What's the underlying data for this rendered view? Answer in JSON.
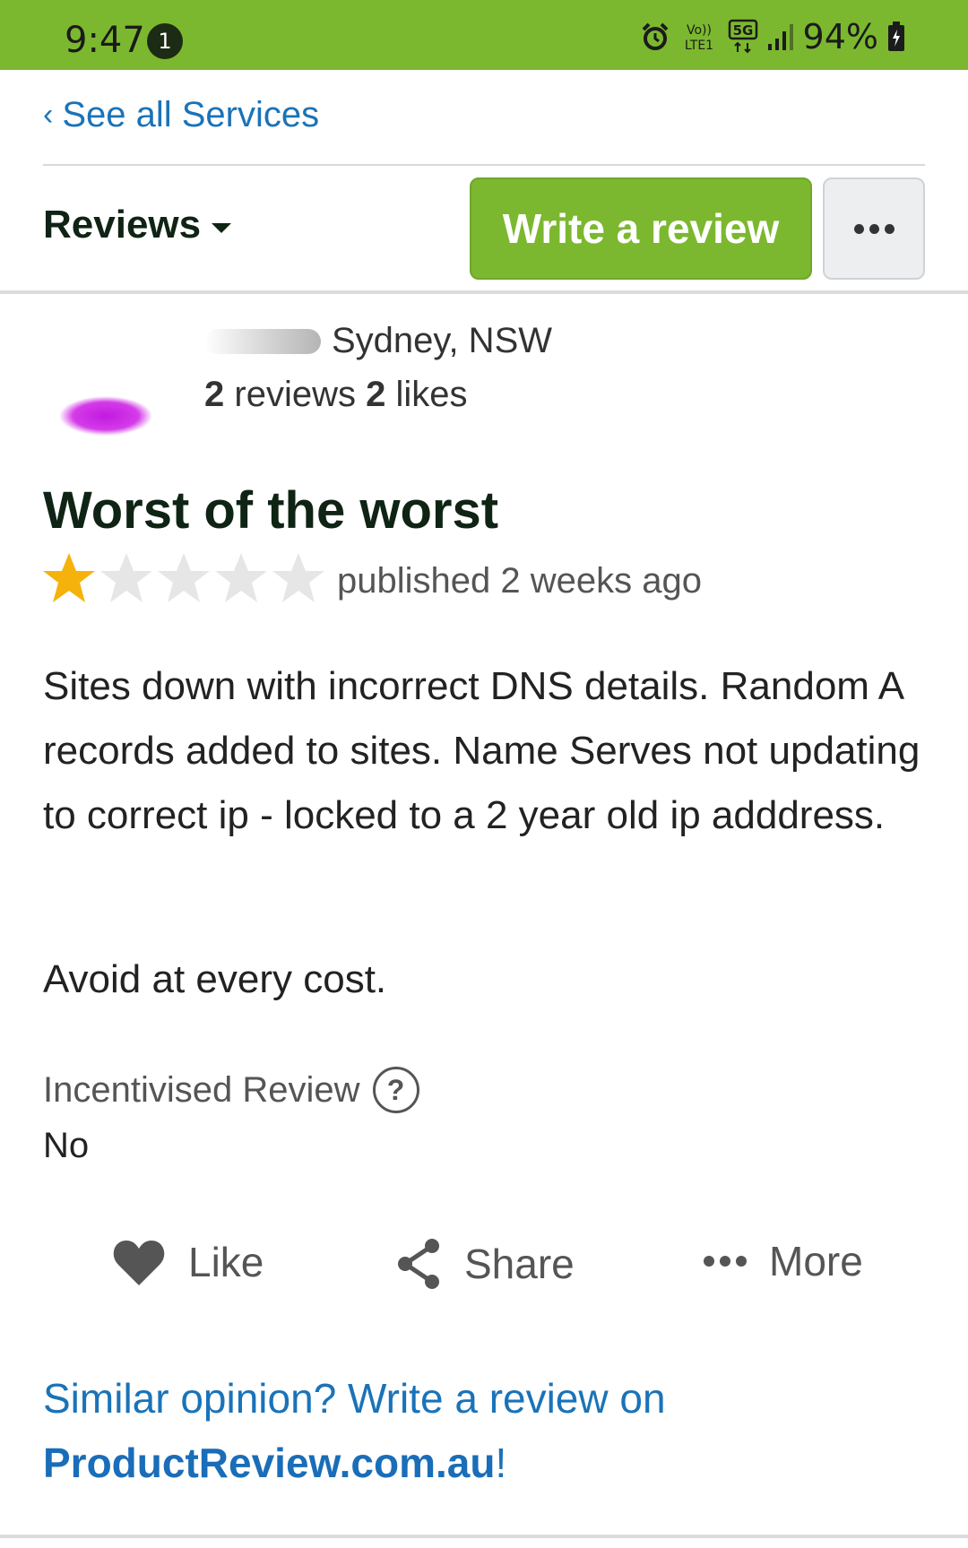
{
  "status_bar": {
    "time": "9:47",
    "notification_count": "1",
    "network_labels": [
      "Vo))",
      "LTE1",
      "5G"
    ],
    "battery": "94%",
    "icons": [
      "alarm-icon",
      "volte-icon",
      "5g-icon",
      "signal-icon",
      "battery-charging-icon"
    ],
    "background_color": "#7cb82f"
  },
  "nav": {
    "back_label": "See all Services"
  },
  "toolbar": {
    "reviews_label": "Reviews",
    "write_review_label": "Write a review",
    "accent_color": "#7cb82f"
  },
  "reviewer": {
    "location": "Sydney, NSW",
    "reviews_count": "2",
    "reviews_word": "reviews",
    "likes_count": "2",
    "likes_word": "likes"
  },
  "review": {
    "title": "Worst of the worst",
    "rating": 1,
    "max_rating": 5,
    "published": "published 2 weeks ago",
    "body": "Sites down with incorrect DNS details. Random A records added to sites. Name Serves not updating to correct ip - locked to a 2 year old ip adddress.",
    "closing": "Avoid at every cost."
  },
  "incentivised": {
    "label": "Incentivised Review",
    "help_symbol": "?",
    "value": "No"
  },
  "actions": {
    "like_label": "Like",
    "share_label": "Share",
    "more_label": "More"
  },
  "cta": {
    "text": "Similar opinion? Write a review on",
    "link": "ProductReview.com.au",
    "suffix": "!"
  }
}
